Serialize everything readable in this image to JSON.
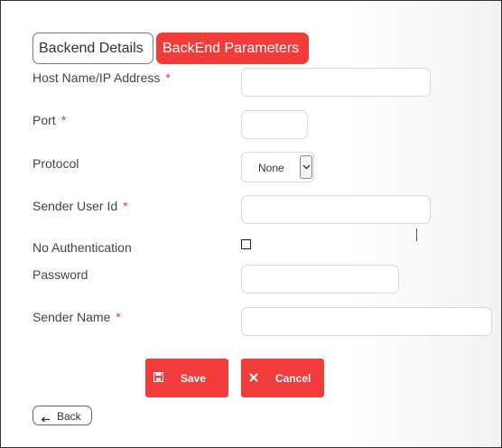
{
  "tabs": {
    "details_label": "Backend Details",
    "parameters_label": "BackEnd Parameters"
  },
  "form": {
    "host_label": "Host Name/IP Address",
    "port_label": "Port",
    "protocol_label": "Protocol",
    "protocol_value": "None",
    "sender_user_id_label": "Sender User Id",
    "no_auth_label": "No Authentication",
    "no_auth_checked": false,
    "password_label": "Password",
    "sender_name_label": "Sender Name",
    "required_marker": "*"
  },
  "actions": {
    "save_label": "Save",
    "cancel_label": "Cancel",
    "back_label": "Back"
  },
  "colors": {
    "accent": "#f23b3b",
    "required": "#e53935"
  },
  "icons": [
    "save-icon",
    "close-icon",
    "arrow-left-icon",
    "chevron-down-icon"
  ]
}
